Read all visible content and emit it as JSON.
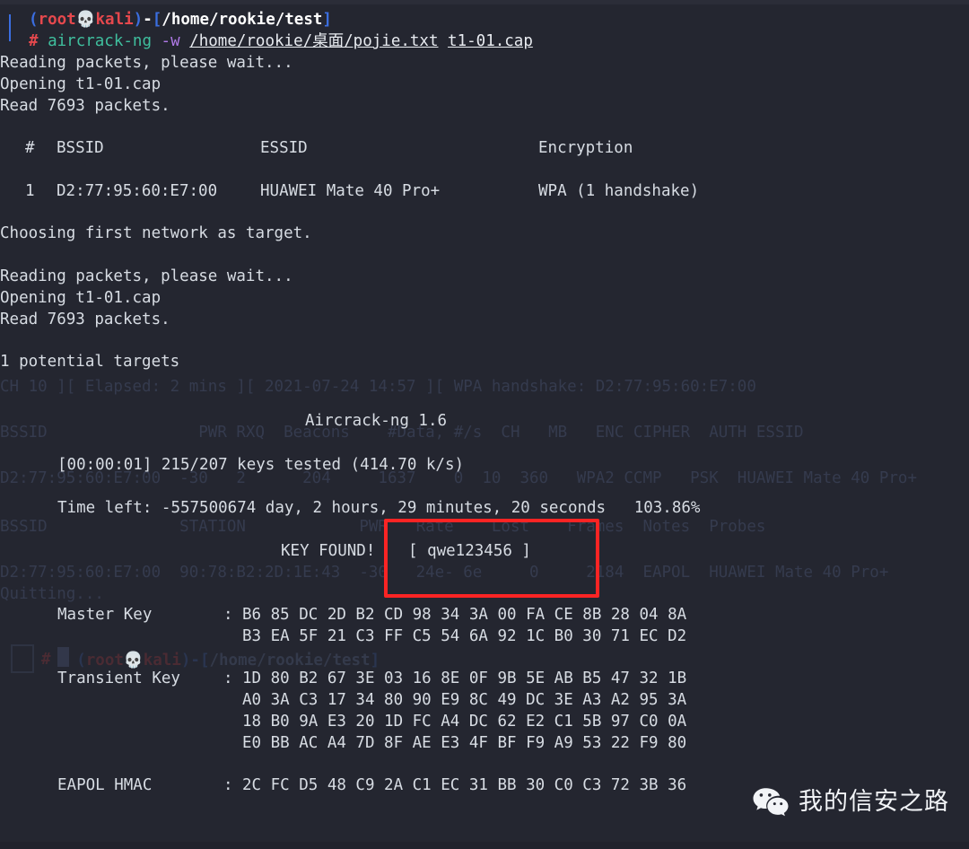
{
  "terminal": {
    "background_color": "#242630",
    "foreground_color": "#d7dce3",
    "prompt": {
      "paren_open": "(",
      "user": "root",
      "skull_icon": "skull-icon",
      "host": "kali",
      "paren_close": ")",
      "dash": "-",
      "bracket_open": "[",
      "path": "/home/rookie/test",
      "bracket_close": "]",
      "hash": "#",
      "command": "aircrack-ng",
      "flag": "-w",
      "wordlist_path": "/home/rookie/桌面/pojie.txt",
      "capture_file": "t1-01.cap"
    },
    "output_lines": [
      "Reading packets, please wait...",
      "Opening t1-01.cap",
      "Read 7693 packets."
    ],
    "network_table": {
      "headers": [
        "#",
        "BSSID",
        "ESSID",
        "Encryption"
      ],
      "rows": [
        {
          "index": "1",
          "bssid": "D2:77:95:60:E7:00",
          "essid": "HUAWEI Mate 40 Pro+",
          "encryption": "WPA (1 handshake)"
        }
      ]
    },
    "target_line": "Choosing first network as target.",
    "output_lines_2": [
      "Reading packets, please wait...",
      "Opening t1-01.cap",
      "Read 7693 packets."
    ],
    "targets_line": "1 potential targets",
    "aircrack": {
      "version_title": "Aircrack-ng 1.6",
      "progress_line": "[00:00:01] 215/207 keys tested (414.70 k/s)",
      "time_left_label": "Time left:",
      "time_left_value": "-557500674 day, 2 hours, 29 minutes, 20 seconds",
      "percent": "103.86%",
      "key_found_label": "KEY FOUND!",
      "key_found_value": "[ qwe123456 ]",
      "key_highlight_color": "#fb2424",
      "master_key_label": "Master Key",
      "master_key_rows": [
        "B6 85 DC 2D B2 CD 98 34 3A 00 FA CE 8B 28 04 8A",
        "B3 EA 5F 21 C3 FF C5 54 6A 92 1C B0 30 71 EC D2"
      ],
      "transient_key_label": "Transient Key",
      "transient_key_rows": [
        "1D 80 B2 67 3E 03 16 8E 0F 9B 5E AB B5 47 32 1B",
        "A0 3A C3 17 34 80 90 E9 8C 49 DC 3E A3 A2 95 3A",
        "18 B0 9A E3 20 1D FC A4 DC 62 E2 C1 5B 97 C0 0A",
        "E0 BB AC A4 7D 8F AE E3 4F BF F9 A9 53 22 F9 80"
      ],
      "eapol_hmac_label": "EAPOL HMAC",
      "eapol_hmac_row": "2C FC D5 48 C9 2A C1 EC 31 BB 30 C0 C3 72 3B 36",
      "colon": ":"
    },
    "ghost": {
      "note": "burned-in previous airodump-ng screen",
      "status_line": "CH 10 ][ Elapsed: 2 mins ][ 2021-07-24 14:57 ][ WPA handshake: D2:77:95:60:E7:00",
      "ap_header": "BSSID                PWR RXQ  Beacons    #Data, #/s  CH   MB   ENC CIPHER  AUTH ESSID",
      "ap_row": "D2:77:95:60:E7:00  -30   2      204     1637    0  10  360   WPA2 CCMP   PSK  HUAWEI Mate 40 Pro+",
      "station_header": "BSSID              STATION            PWR   Rate    Lost    Frames  Notes  Probes",
      "station_row": "D2:77:95:60:E7:00  90:78:B2:2D:1E:43  -30   24e- 6e     0     2184  EAPOL  HUAWEI Mate 40 Pro+",
      "quitting": "Quitting...",
      "prompt_user": "root",
      "prompt_host": "kali",
      "prompt_path": "/home/rookie/test",
      "prompt_hash": "#"
    }
  },
  "watermark": {
    "icon": "wechat-icon",
    "text": "我的信安之路"
  }
}
